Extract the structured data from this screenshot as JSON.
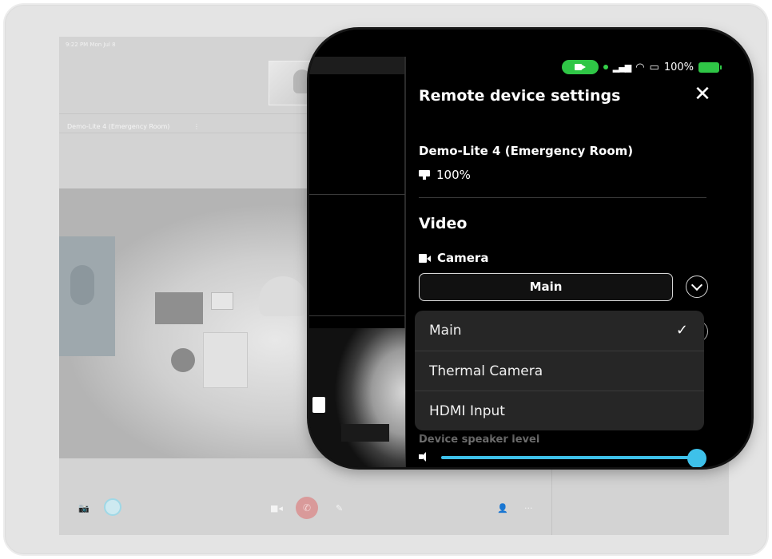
{
  "background": {
    "status_time": "9:22 PM  Mon Jul 8",
    "device_tab": "Demo-Lite 4 (Emergency Room)",
    "device_tab_more": "⋮",
    "bottom_icons": [
      "📷",
      "■◂",
      "✆",
      "✎",
      "👤",
      "···"
    ]
  },
  "status_bar": {
    "signal": "▂▄▆",
    "wifi": "◠",
    "battery_percent": "100%",
    "colors": {
      "call_pill": "#2fc646",
      "battery": "#2fc646"
    }
  },
  "panel": {
    "title": "Remote device settings",
    "close_label": "✕",
    "device_name": "Demo-Lite 4 (Emergency Room)",
    "device_battery": "100%",
    "video_section": "Video",
    "camera_label": "Camera",
    "camera_selected": "Main",
    "dropdown": {
      "options": [
        "Main",
        "Thermal Camera",
        "HDMI Input"
      ],
      "checked_index": 0,
      "check_mark": "✓"
    },
    "partial_label": "Device speaker level",
    "speaker_level": 1.0,
    "accent_color": "#3ec1ea"
  }
}
